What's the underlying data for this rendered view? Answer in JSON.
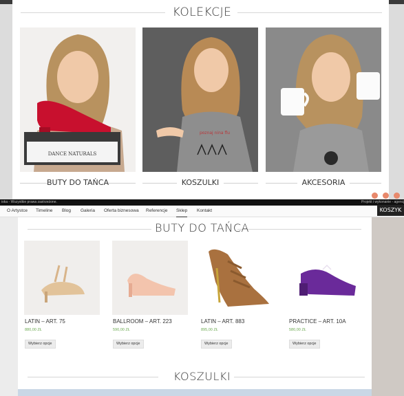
{
  "collections": {
    "title": "KOLEKCJE",
    "items": [
      {
        "label": "BUTY DO TAŃCA"
      },
      {
        "label": "KOSZULKI"
      },
      {
        "label": "AKCESORIA"
      }
    ]
  },
  "footer": {
    "left_text": "ioka - Wszystkie prawa zastrzeżone.",
    "right_text": "Projekt i wykonanie - agencja int"
  },
  "nav": {
    "items": [
      "O Artystce",
      "Timeline",
      "Blog",
      "Galeria",
      "Oferta biznesowa",
      "Referencje",
      "Sklep",
      "Kontakt"
    ],
    "active": "Sklep",
    "cart_label": "KOSZYK"
  },
  "shop": {
    "title": "BUTY DO TAŃCA",
    "products": [
      {
        "name": "LATIN – ART. 75",
        "price": "880,00 ZŁ",
        "button": "Wybierz opcje"
      },
      {
        "name": "BALLROOM – ART. 223",
        "price": "590,00 ZŁ",
        "button": "Wybierz opcje"
      },
      {
        "name": "LATIN – ART. 883",
        "price": "895,00 ZŁ",
        "button": "Wybierz opcje"
      },
      {
        "name": "PRACTICE – ART. 10A",
        "price": "580,00 ZŁ",
        "button": "Wybierz opcje"
      }
    ],
    "next_section_title": "KOSZULKI"
  },
  "box_brand": "DANCE NATURALS",
  "shirt_print": "poznaj nina flu",
  "colors": {
    "price": "#6aa84f",
    "social": "#e8896c",
    "nav_bg": "#fafafa",
    "cart_bg": "#222222"
  },
  "icons": [
    "facebook-icon",
    "instagram-icon",
    "youtube-icon"
  ]
}
